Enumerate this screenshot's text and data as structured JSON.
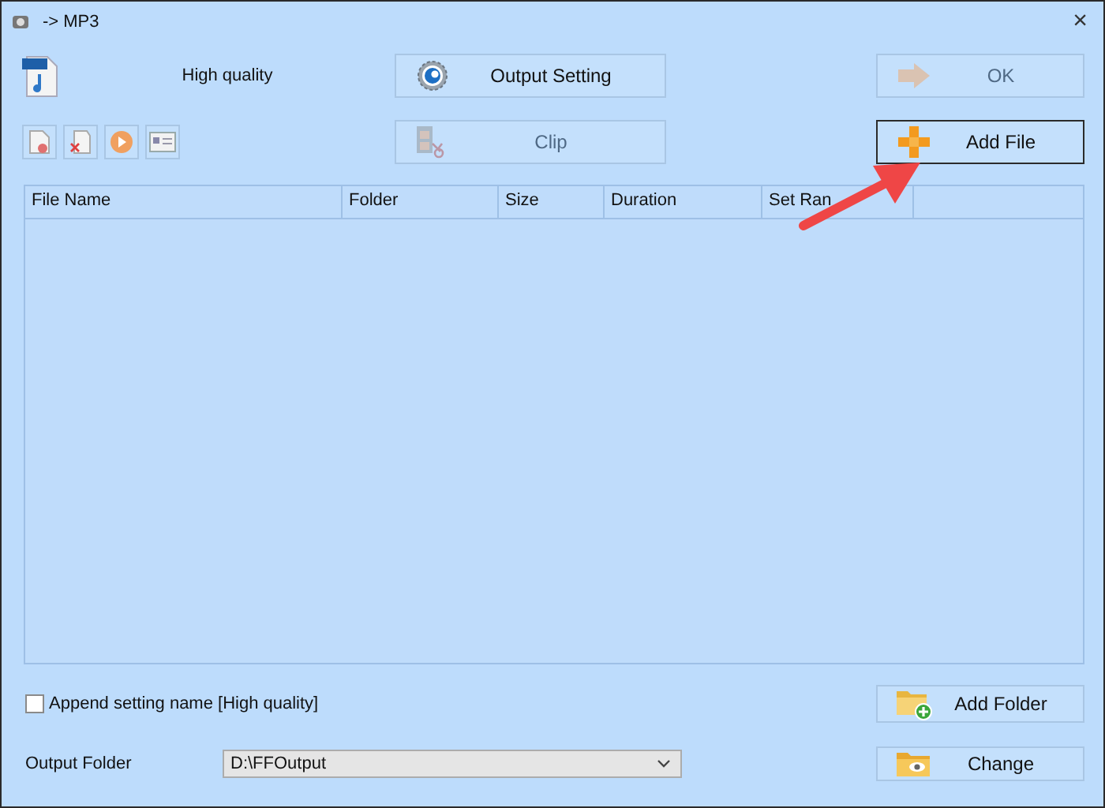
{
  "window": {
    "title": "-> MP3",
    "close": "×"
  },
  "profile": {
    "label": "High quality"
  },
  "output_setting_button": {
    "label": "Output Setting",
    "disabled": false,
    "focused": false
  },
  "ok_button": {
    "label": "OK",
    "disabled": true,
    "focused": false
  },
  "toolbar": [
    {
      "kind": "remove"
    },
    {
      "kind": "delete"
    },
    {
      "kind": "play"
    },
    {
      "kind": "info"
    }
  ],
  "clip_button": {
    "label": "Clip",
    "disabled": true,
    "focused": false
  },
  "add_file_button": {
    "label": "Add File",
    "disabled": false,
    "focused": true
  },
  "table": {
    "columns": [
      "File Name",
      "Folder",
      "Size",
      "Duration",
      "Set Ran"
    ]
  },
  "annotation": {
    "kind": "arrow"
  },
  "append_setting": {
    "label": "Append setting name [High quality]",
    "checked": false
  },
  "add_folder_button": {
    "label": "Add Folder",
    "disabled": false,
    "focused": false
  },
  "output_folder": {
    "label": "Output Folder",
    "value": "D:\\FFOutput"
  },
  "change_button": {
    "label": "Change",
    "disabled": false,
    "focused": false
  }
}
